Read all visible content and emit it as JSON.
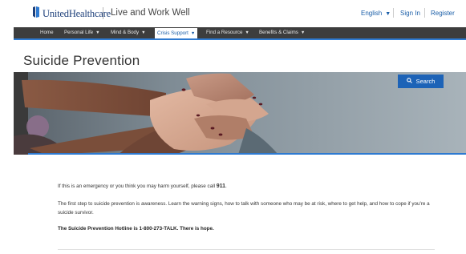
{
  "header": {
    "brand": "UnitedHealthcare",
    "tagline": "Live and Work Well",
    "language": "English",
    "sign_in": "Sign In",
    "register": "Register"
  },
  "nav": {
    "items": [
      {
        "label": "Home",
        "dropdown": false
      },
      {
        "label": "Personal Life",
        "dropdown": true
      },
      {
        "label": "Mind & Body",
        "dropdown": true
      },
      {
        "label": "Crisis Support",
        "dropdown": true,
        "active": true
      },
      {
        "label": "Find a Resource",
        "dropdown": true
      },
      {
        "label": "Benefits & Claims",
        "dropdown": true
      }
    ]
  },
  "page": {
    "title": "Suicide Prevention",
    "search_label": "Search"
  },
  "content": {
    "p1_before": "If this is an emergency or you think you may harm yourself, please call ",
    "p1_number": "911",
    "p1_after": ".",
    "p2": "The first step to suicide prevention is awareness. Learn the warning signs, how to talk with someone who may be at risk, where to get help, and how to cope if you're a suicide survivor.",
    "p3": "The Suicide Prevention Hotline is 1-800-273-TALK. There is hope."
  },
  "colors": {
    "brand_blue": "#1d63b7",
    "nav_bg": "#3d3d3d",
    "accent": "#2e7ad1"
  }
}
